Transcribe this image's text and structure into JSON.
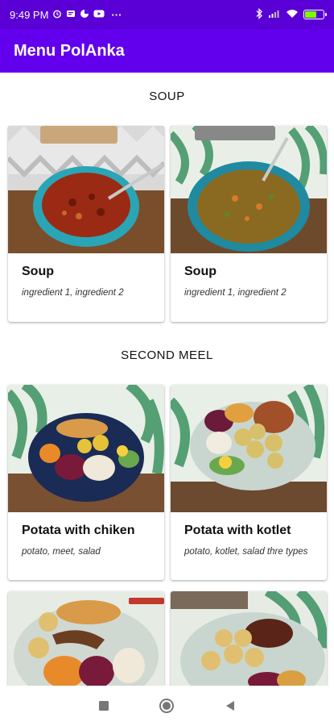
{
  "status_bar": {
    "time": "9:49 PM",
    "icons_left": [
      "alarm-icon",
      "notification-icon",
      "app-icon",
      "youtube-icon",
      "more-icon"
    ],
    "icons_right": [
      "bluetooth-icon",
      "signal-icon",
      "wifi-icon",
      "battery-icon"
    ],
    "battery_level": 0.6,
    "more": "···"
  },
  "app_bar": {
    "title": "Menu PolAnka"
  },
  "sections": [
    {
      "title": "SOUP",
      "items": [
        {
          "name": "Soup",
          "ingredients": "ingredient 1, ingredient 2"
        },
        {
          "name": "Soup",
          "ingredients": "ingredient 1, ingredient 2"
        }
      ]
    },
    {
      "title": "SECOND MEEL",
      "items": [
        {
          "name": "Potata with chiken",
          "ingredients": "potato, meet, salad"
        },
        {
          "name": "Potata with kotlet",
          "ingredients": "potato, kotlet, salad thre types"
        }
      ]
    }
  ],
  "nav_bar": {
    "buttons": [
      "recents-icon",
      "home-icon",
      "back-icon"
    ]
  },
  "colors": {
    "status_bar": "#5a00d6",
    "app_bar": "#6200ee"
  }
}
